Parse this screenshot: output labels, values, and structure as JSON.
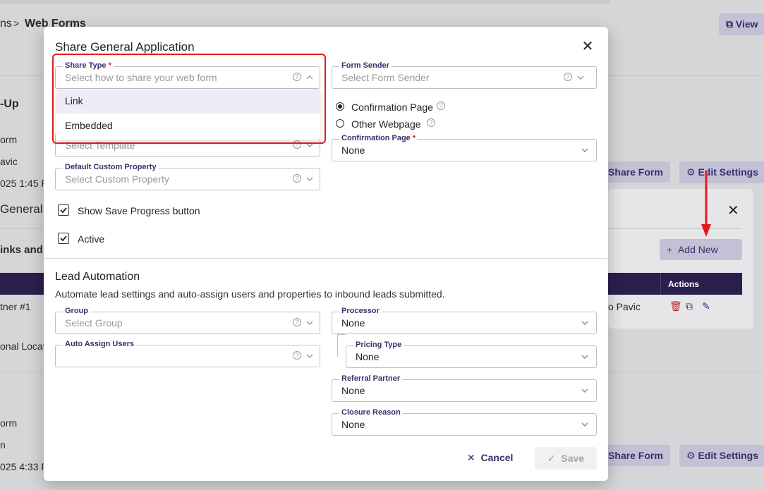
{
  "background": {
    "breadcrumb_prev": "ns",
    "breadcrumb_sep": ">",
    "breadcrumb_current": "Web Forms",
    "view_button": "View",
    "heading_partial": "-Up",
    "line1": "orm",
    "line2": "avic",
    "line3": "025 1:45 F",
    "share_form_1": "Share Form",
    "edit_settings_1": "Edit Settings",
    "general_partial": "General",
    "links_partial": "inks and",
    "add_new": "Add New",
    "actions_header": "Actions",
    "partner_partial": "tner #1",
    "pavic_partial": "o Pavic",
    "location_partial": "onal Locati",
    "line4": "orm",
    "line5": "n",
    "line6": "025 4:33 F",
    "share_form_2": "Share Form",
    "edit_settings_2": "Edit Settings"
  },
  "modal": {
    "title": "Share General Application",
    "share_type": {
      "label": "Share Type",
      "required_mark": "*",
      "placeholder": "Select how to share your web form",
      "options": [
        "Link",
        "Embedded"
      ]
    },
    "template": {
      "placeholder": "Select Template"
    },
    "default_custom_property": {
      "label": "Default Custom Property",
      "placeholder": "Select Custom Property"
    },
    "show_save_progress": {
      "label": "Show Save Progress button",
      "checked": true
    },
    "active": {
      "label": "Active",
      "checked": true
    },
    "form_sender": {
      "label": "Form Sender",
      "placeholder": "Select Form Sender"
    },
    "confirmation_options": {
      "confirmation_page": "Confirmation Page",
      "other_webpage": "Other Webpage",
      "selected": "Confirmation Page"
    },
    "confirmation_page_select": {
      "label": "Confirmation Page",
      "required_mark": "*",
      "value": "None"
    },
    "lead_automation": {
      "title": "Lead Automation",
      "description": "Automate lead settings and auto-assign users and properties to inbound leads submitted.",
      "group": {
        "label": "Group",
        "placeholder": "Select Group"
      },
      "auto_assign_users": {
        "label": "Auto Assign Users",
        "value": ""
      },
      "processor": {
        "label": "Processor",
        "value": "None"
      },
      "pricing_type": {
        "label": "Pricing Type",
        "value": "None"
      },
      "referral_partner": {
        "label": "Referral Partner",
        "value": "None"
      },
      "closure_reason": {
        "label": "Closure Reason",
        "value": "None"
      }
    },
    "cancel_label": "Cancel",
    "save_label": "Save"
  },
  "colors": {
    "accent": "#3a2f6a",
    "required": "#c62828",
    "highlight": "#e3191c",
    "table_header": "#2b1f4e"
  }
}
